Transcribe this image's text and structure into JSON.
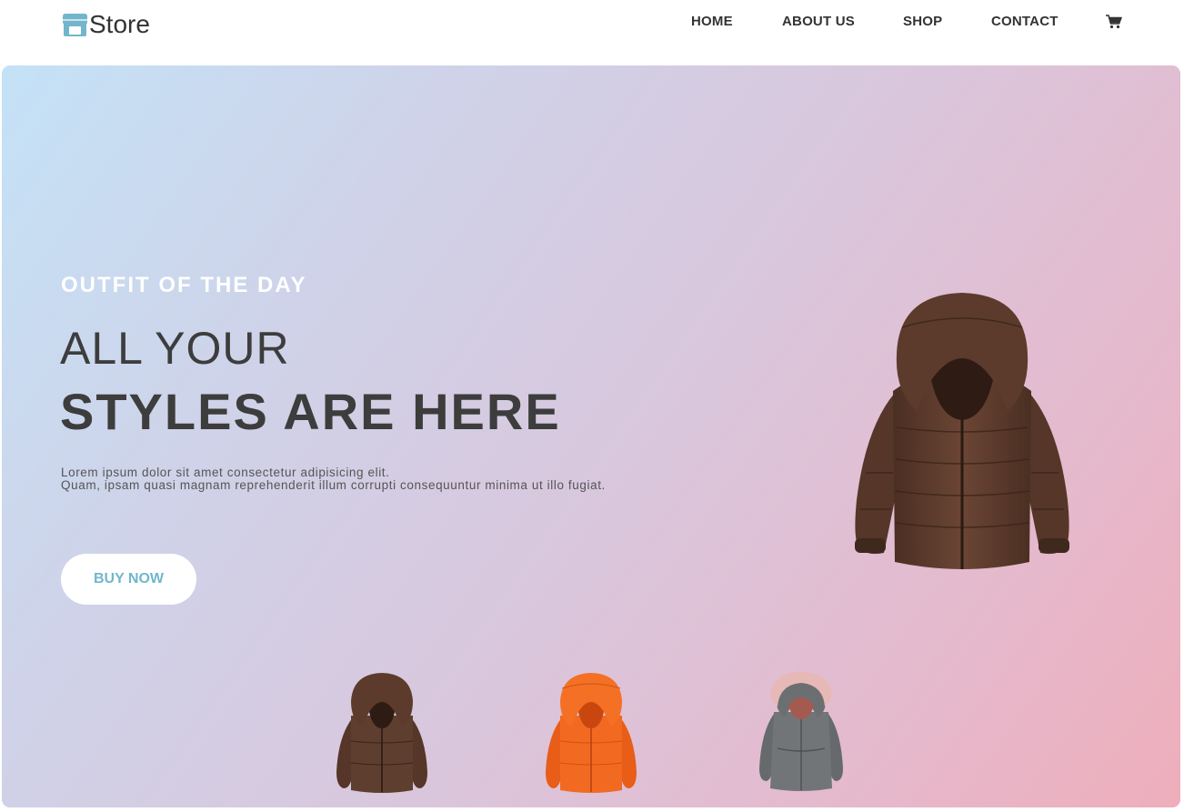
{
  "brand": {
    "name": "Store",
    "icon": "storefront-icon",
    "icon_color": "#72b6cc"
  },
  "nav": {
    "items": [
      {
        "label": "HOME"
      },
      {
        "label": "ABOUT US"
      },
      {
        "label": "SHOP"
      },
      {
        "label": "CONTACT"
      }
    ],
    "cart_icon": "cart-icon"
  },
  "hero": {
    "eyebrow": "OUTFIT OF THE DAY",
    "headline_line1": "ALL YOUR",
    "headline_line2": "STYLES ARE HERE",
    "description_line1": "Lorem ipsum dolor sit amet consectetur adipisicing elit.",
    "description_line2": "Quam, ipsam quasi magnam reprehenderit illum corrupti consequuntur minima ut illo fugiat.",
    "button_label": "BUY NOW",
    "featured_product": "brown-puffer-jacket",
    "thumbnails": [
      {
        "name": "brown-puffer-jacket",
        "color": "#5a3a2a"
      },
      {
        "name": "orange-puffer-jacket",
        "color": "#f26a22"
      },
      {
        "name": "gray-fur-hood-parka",
        "color": "#6e7173"
      }
    ]
  },
  "colors": {
    "accent": "#72b6cc",
    "text": "#3d3d3d",
    "gradient_start": "#c4e2f7",
    "gradient_end": "#eeaebb"
  }
}
